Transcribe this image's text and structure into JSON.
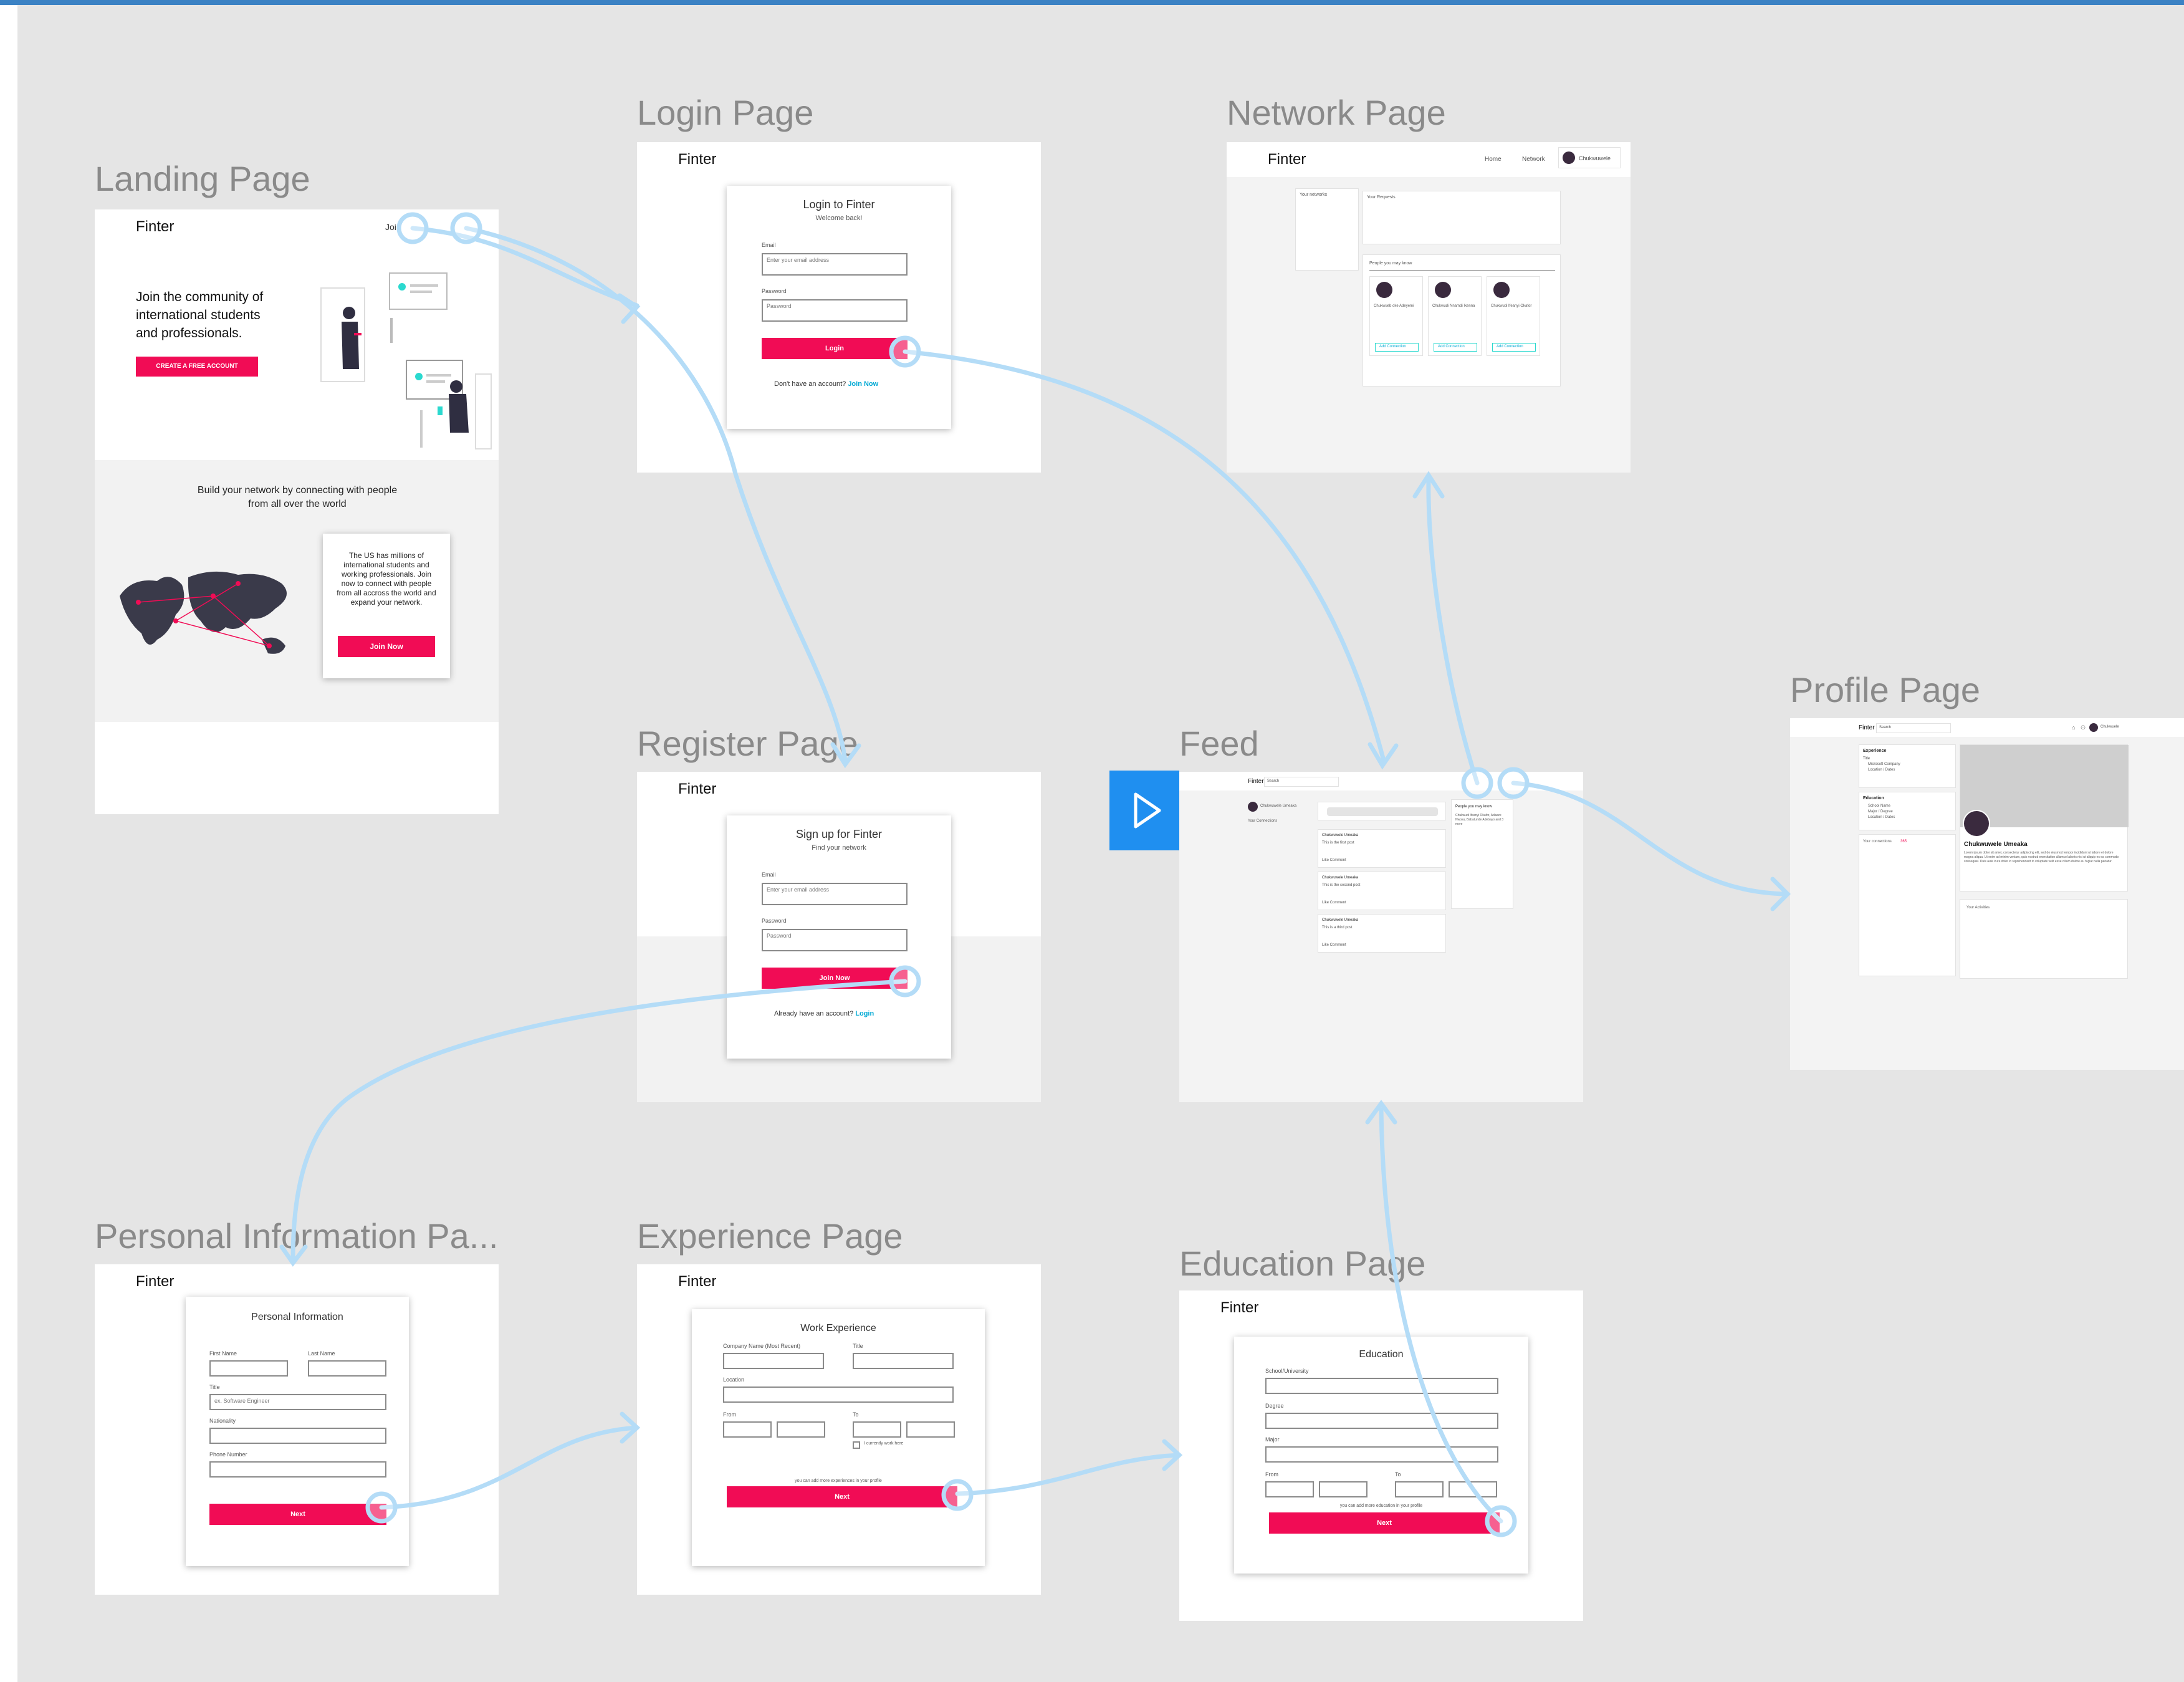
{
  "frames": {
    "landing": {
      "title": "Landing Page",
      "brand": "Finter",
      "nav_text": "Joi",
      "hero": "Join the community of international students and professionals.",
      "cta": "CREATE A FREE ACCOUNT",
      "section_heading": "Build your network by connecting with people from all over the world",
      "card_text": "The US has millions of international students and working professionals. Join now to connect with people from all accross the world and expand your network.",
      "join_button": "Join Now"
    },
    "login": {
      "title": "Login Page",
      "brand": "Finter",
      "heading": "Login to Finter",
      "subheading": "Welcome back!",
      "email_label": "Email",
      "email_placeholder": "Enter your email address",
      "password_label": "Password",
      "password_placeholder": "Password",
      "button": "Login",
      "footer_text": "Don't have an account?",
      "footer_link": "Join Now"
    },
    "network": {
      "title": "Network Page",
      "brand": "Finter",
      "nav": [
        "Home",
        "Network",
        "Chukwuwele"
      ],
      "your_networks": "Your networks",
      "your_requests": "Your Requests",
      "people_heading": "People you may know",
      "people": [
        {
          "name": "Chukwueb oke Adeyemi",
          "button": "Add Connection"
        },
        {
          "name": "Chukwudi Nnamdi Ikenna",
          "button": "Add Connection"
        },
        {
          "name": "Chukwudi Ifeanyi Okafor",
          "button": "Add Connection"
        }
      ]
    },
    "profile": {
      "title": "Profile Page",
      "brand": "Finter",
      "search": "Search",
      "nav_user": "Chukwuele",
      "experience_heading": "Experience",
      "experience_lines": [
        "Title",
        "Microsoft Company",
        "Location / Dates"
      ],
      "education_heading": "Education",
      "education_lines": [
        "School Name",
        "Major / Degree",
        "Location / Dates"
      ],
      "connections_label": "Your connections",
      "connections_count": "365",
      "name": "Chukwuwele Umeaka",
      "bio": "Lorem ipsum dolor sit amet, consectetur adipiscing elit, sed do eiusmod tempor incididunt ut labore et dolore magna aliqua. Ut enim ad minim veniam, quis nostrud exercitation ullamco laboris nisi ut aliquip ex ea commodo consequat. Duis aute irure dolor in reprehenderit in voluptate velit esse cillum dolore eu fugiat nulla pariatur.",
      "activities": "Your Activities"
    },
    "register": {
      "title": "Register Page",
      "brand": "Finter",
      "heading": "Sign up for Finter",
      "subheading": "Find your network",
      "email_label": "Email",
      "email_placeholder": "Enter your email address",
      "password_label": "Password",
      "password_placeholder": "Password",
      "button": "Join Now",
      "footer_text": "Already have an account?",
      "footer_link": "Login"
    },
    "feed": {
      "title": "Feed",
      "brand": "Finter",
      "search": "Search",
      "user": "Chukwuwele Umeaka",
      "connections": "Your Connections",
      "people_title": "People you may know",
      "people_text": "Chukwudi Ifeanyi Okafor, Adaeze Nwosu, Babatunde Adebayo and 3 more",
      "posts": [
        {
          "author": "Chukwuwele Umeaka",
          "text": "This is the first post",
          "actions": "Like   Comment"
        },
        {
          "author": "Chukwuwele Umeaka",
          "text": "This is the second post",
          "actions": "Like   Comment"
        },
        {
          "author": "Chukwuwele Umeaka",
          "text": "This is a third post",
          "actions": "Like   Comment"
        }
      ]
    },
    "personal": {
      "title": "Personal Information Pa...",
      "brand": "Finter",
      "heading": "Personal Information",
      "first_name": "First Name",
      "last_name": "Last Name",
      "title_label": "Title",
      "title_value": "ex. Software Engineer",
      "nationality": "Nationality",
      "phone": "Phone Number",
      "button": "Next"
    },
    "experience": {
      "title": "Experience Page",
      "brand": "Finter",
      "heading": "Work Experience",
      "company": "Company Name (Most Recent)",
      "title_label": "Title",
      "location": "Location",
      "from": "From",
      "to": "To",
      "current": "I currently work here",
      "note": "you can add more experiences in your profile",
      "button": "Next"
    },
    "education": {
      "title": "Education Page",
      "brand": "Finter",
      "heading": "Education",
      "school": "School/University",
      "degree": "Degree",
      "major": "Major",
      "from": "From",
      "to": "To",
      "note": "you can add more education in your profile",
      "button": "Next"
    }
  },
  "colors": {
    "accent": "#f10c55",
    "link": "#00a9d4",
    "connector": "#b4dcf7",
    "play": "#1f8ff0",
    "canvas": "#e5e5e5"
  },
  "icons": [
    "play-icon",
    "world-map-illustration",
    "person-phone-illustration",
    "chat-bubble-illustration",
    "avatar-icon"
  ]
}
